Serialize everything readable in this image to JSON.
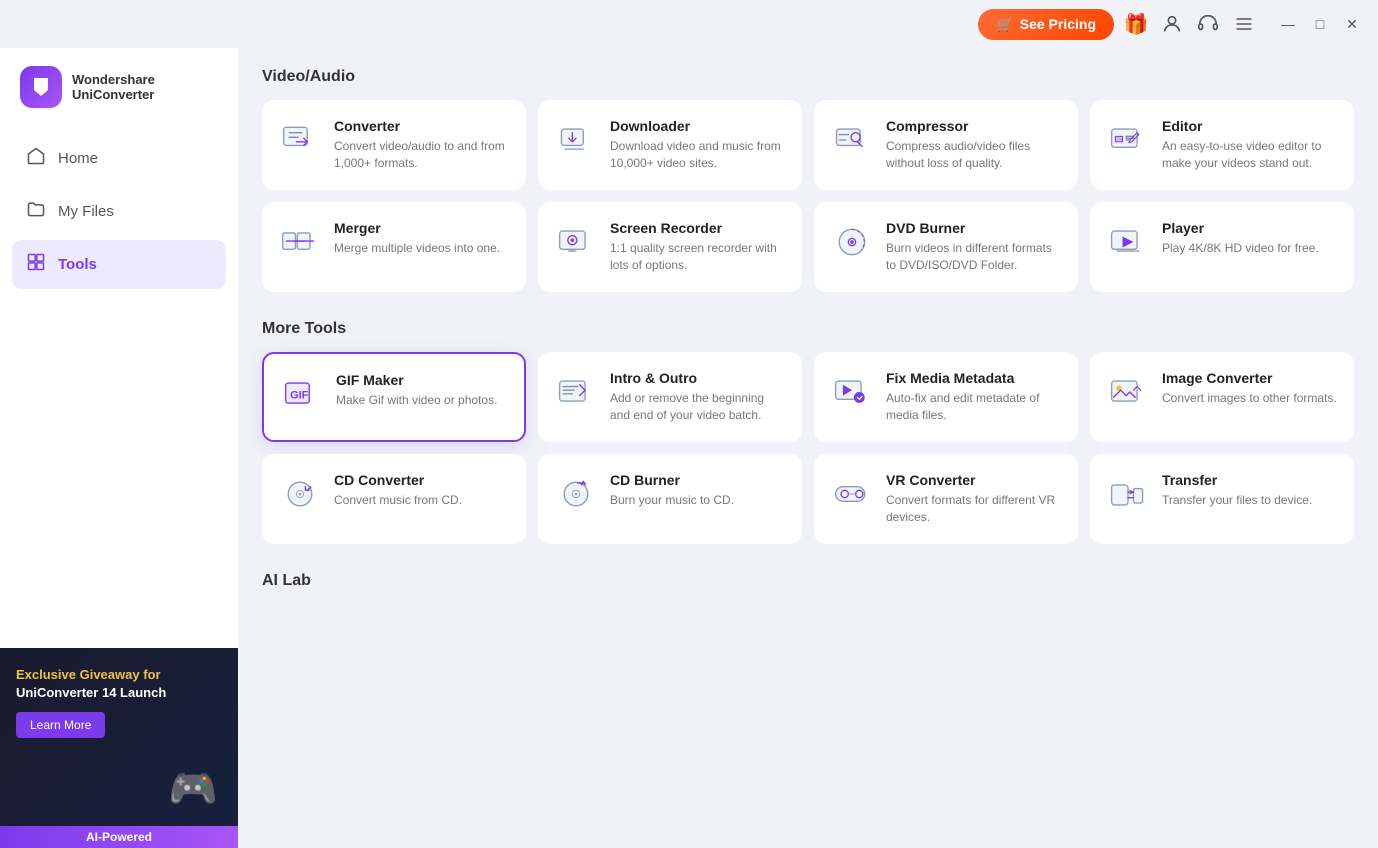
{
  "app": {
    "brand": "Wondershare",
    "product": "UniConverter"
  },
  "titlebar": {
    "see_pricing": "See Pricing",
    "minimize": "—",
    "maximize": "□",
    "close": "✕"
  },
  "sidebar": {
    "nav": [
      {
        "id": "home",
        "label": "Home",
        "icon": "🏠"
      },
      {
        "id": "myfiles",
        "label": "My Files",
        "icon": "📁"
      },
      {
        "id": "tools",
        "label": "Tools",
        "icon": "🧰",
        "active": true
      }
    ],
    "promo": {
      "line1": "Exclusive Giveaway for",
      "line2": "UniConverter 14 Launch",
      "learn_more": "Learn More",
      "ai_badge": "AI-Powered"
    }
  },
  "sections": [
    {
      "id": "video-audio",
      "title": "Video/Audio",
      "tools": [
        {
          "id": "converter",
          "name": "Converter",
          "desc": "Convert video/audio to and from 1,000+ formats.",
          "icon": "converter"
        },
        {
          "id": "downloader",
          "name": "Downloader",
          "desc": "Download video and music from 10,000+ video sites.",
          "icon": "downloader"
        },
        {
          "id": "compressor",
          "name": "Compressor",
          "desc": "Compress audio/video files without loss of quality.",
          "icon": "compressor"
        },
        {
          "id": "editor",
          "name": "Editor",
          "desc": "An easy-to-use video editor to make your videos stand out.",
          "icon": "editor"
        },
        {
          "id": "merger",
          "name": "Merger",
          "desc": "Merge multiple videos into one.",
          "icon": "merger"
        },
        {
          "id": "screen-recorder",
          "name": "Screen Recorder",
          "desc": "1:1 quality screen recorder with lots of options.",
          "icon": "screen-recorder"
        },
        {
          "id": "dvd-burner",
          "name": "DVD Burner",
          "desc": "Burn videos in different formats to DVD/ISO/DVD Folder.",
          "icon": "dvd-burner"
        },
        {
          "id": "player",
          "name": "Player",
          "desc": "Play 4K/8K HD video for free.",
          "icon": "player"
        }
      ]
    },
    {
      "id": "more-tools",
      "title": "More Tools",
      "tools": [
        {
          "id": "gif-maker",
          "name": "GIF Maker",
          "desc": "Make Gif with video or photos.",
          "icon": "gif-maker",
          "active": true
        },
        {
          "id": "intro-outro",
          "name": "Intro & Outro",
          "desc": "Add or remove the beginning and end of your video batch.",
          "icon": "intro-outro"
        },
        {
          "id": "fix-media-metadata",
          "name": "Fix Media Metadata",
          "desc": "Auto-fix and edit metadate of media files.",
          "icon": "fix-media-metadata"
        },
        {
          "id": "image-converter",
          "name": "Image Converter",
          "desc": "Convert images to other formats.",
          "icon": "image-converter"
        },
        {
          "id": "cd-converter",
          "name": "CD Converter",
          "desc": "Convert music from CD.",
          "icon": "cd-converter"
        },
        {
          "id": "cd-burner",
          "name": "CD Burner",
          "desc": "Burn your music to CD.",
          "icon": "cd-burner"
        },
        {
          "id": "vr-converter",
          "name": "VR Converter",
          "desc": "Convert formats for different VR devices.",
          "icon": "vr-converter"
        },
        {
          "id": "transfer",
          "name": "Transfer",
          "desc": "Transfer your files to device.",
          "icon": "transfer"
        }
      ]
    },
    {
      "id": "ai-lab",
      "title": "AI Lab",
      "tools": []
    }
  ]
}
